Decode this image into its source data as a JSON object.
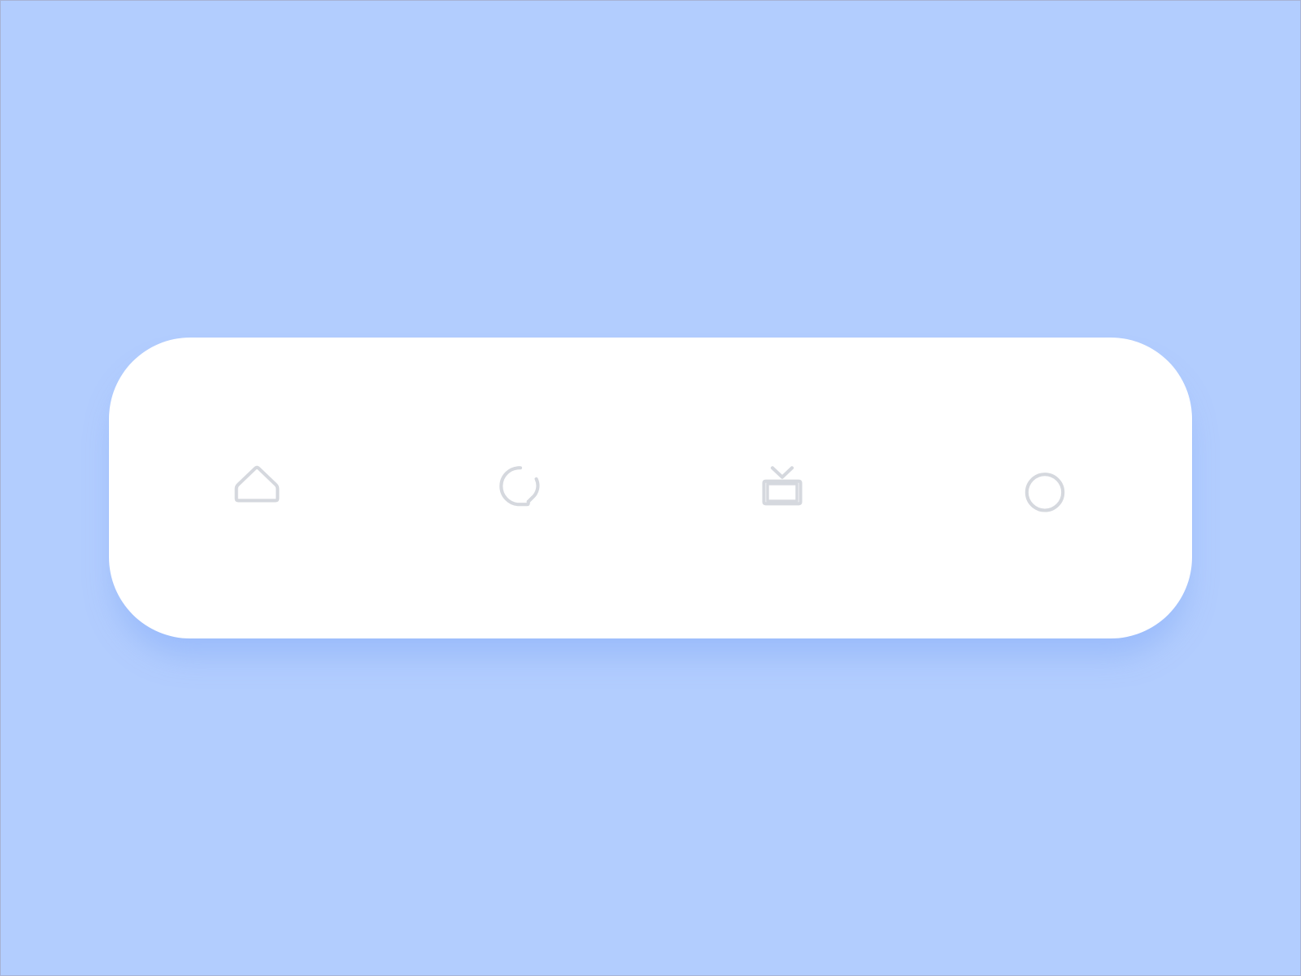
{
  "colors": {
    "background": "#b2cdfe",
    "bar": "#ffffff",
    "icon": "#d5d8de"
  },
  "tabbar": {
    "tabs": [
      {
        "icon": "home-icon"
      },
      {
        "icon": "refresh-icon"
      },
      {
        "icon": "tv-icon"
      },
      {
        "icon": "circle-icon"
      }
    ]
  }
}
